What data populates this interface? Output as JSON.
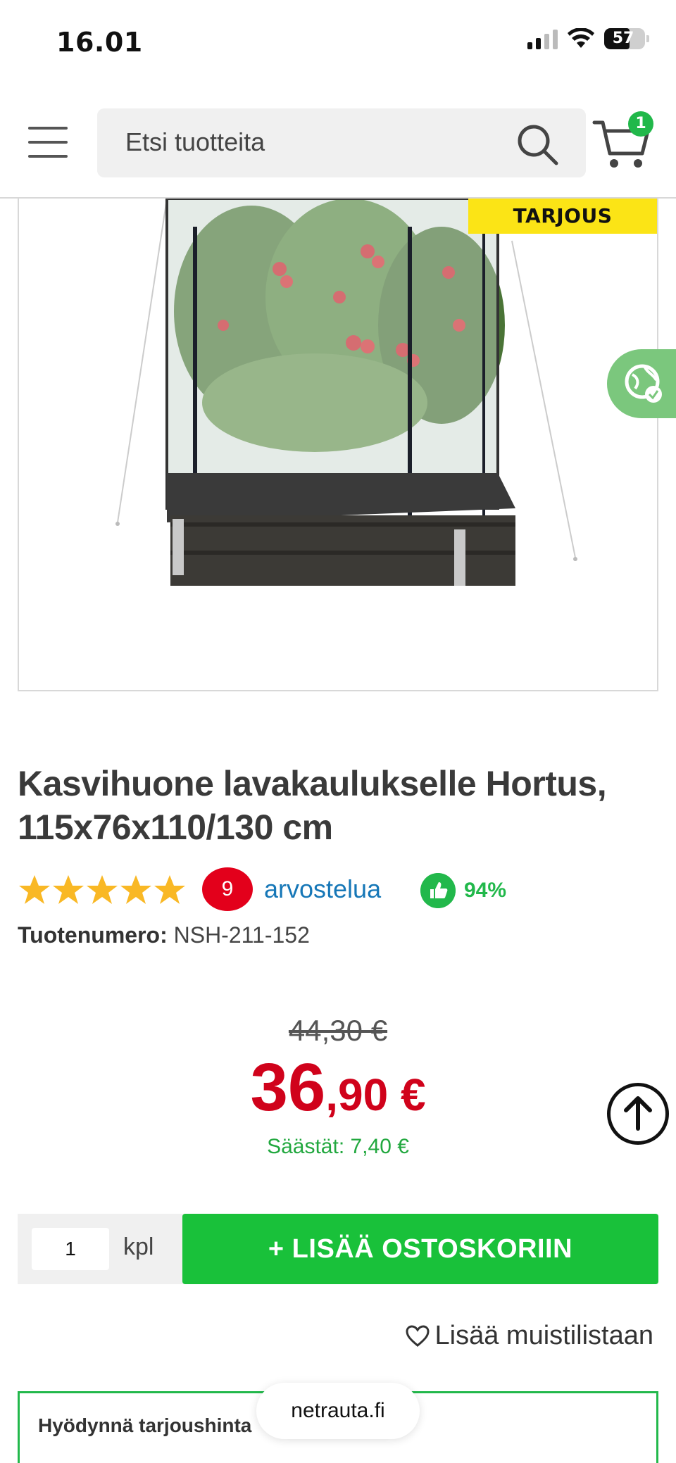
{
  "status_bar": {
    "time": "16.01",
    "battery": "57"
  },
  "header": {
    "search_placeholder": "Etsi tuotteita",
    "cart_count": "1"
  },
  "product": {
    "badge": "TARJOUS",
    "title": "Kasvihuone lavakaulukselle Hortus, 115x76x110/130 cm",
    "rating_stars": 5,
    "review_count": "9",
    "review_label": "arvostelua",
    "recommend_percent": "94%",
    "sku_label": "Tuotenumero:",
    "sku_value": "NSH-211-152"
  },
  "pricing": {
    "old_price": "44,30 €",
    "new_price_euros": "36",
    "new_price_cents": ",90 €",
    "savings": "Säästät: 7,40 €"
  },
  "cart_form": {
    "quantity": "1",
    "unit": "kpl",
    "add_button": "+ LISÄÄ OSTOSKORIIN"
  },
  "wishlist_label": "Lisää muistilistaan",
  "promo": {
    "title": "Hyödynnä tarjoushinta"
  },
  "browser_url": "netrauta.fi",
  "colors": {
    "accent_green": "#19c13a",
    "price_red": "#d0021b",
    "badge_yellow": "#fbe416",
    "link_blue": "#1677b7"
  }
}
